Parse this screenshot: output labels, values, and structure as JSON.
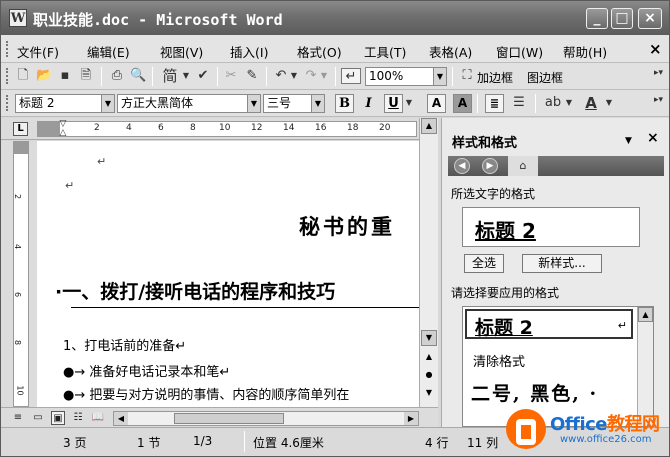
{
  "window": {
    "title": "职业技能.doc - Microsoft Word",
    "min_label": "_",
    "max_label": "□",
    "close_label": "×",
    "doc_close_label": "×"
  },
  "menu": [
    "文件(F)",
    "编辑(E)",
    "视图(V)",
    "插入(I)",
    "格式(O)",
    "工具(T)",
    "表格(A)",
    "窗口(W)",
    "帮助(H)"
  ],
  "toolbar": {
    "zoom": "100%",
    "add_border": "加边框",
    "drawing_border": "图边框",
    "simplified_label": "简"
  },
  "format_bar": {
    "style": "标题 2",
    "font": "方正大黑简体",
    "size": "三号",
    "bold": "B",
    "italic": "I",
    "underline": "U",
    "char_border": "A",
    "char_shading": "A",
    "font_color": "A"
  },
  "ruler": {
    "numbers": [
      "2",
      "4",
      "6",
      "8",
      "10",
      "12",
      "14",
      "16",
      "18",
      "20"
    ],
    "corner": "L"
  },
  "vruler": {
    "numbers": [
      "2",
      "4",
      "6",
      "8",
      "10"
    ]
  },
  "document": {
    "title": "秘书的重",
    "heading": "·一、拨打/接听电话的程序和技巧",
    "line1": "1、打电话前的准备↵",
    "line2": "●→ 准备好电话记录本和笔↵",
    "line3": "●→ 把要与对方说明的事情、内容的顺序简单列在"
  },
  "task_pane": {
    "title": "样式和格式",
    "dropdown": "▼",
    "close": "×",
    "selected_label": "所选文字的格式",
    "selected_style": "标题 2",
    "select_all": "全选",
    "new_style": "新样式...",
    "apply_label": "请选择要应用的格式",
    "list": [
      "标题 2",
      "清除格式",
      "二号, 黑色, ·"
    ]
  },
  "status": {
    "page": "3 页",
    "section": "1 节",
    "page_of": "1/3",
    "position": "位置 4.6厘米",
    "line": "4 行",
    "column": "11 列"
  },
  "watermark": {
    "brand_a": "Office",
    "brand_b": "教程网",
    "site": "www.office26.com"
  },
  "colors": {
    "title_bar": "#6e6e6e",
    "watermark_orange": "#ff6a00",
    "watermark_blue": "#1a6fd0"
  }
}
